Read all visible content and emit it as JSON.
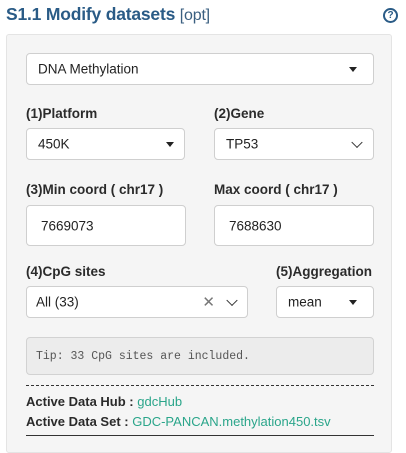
{
  "header": {
    "title": "S1.1 Modify datasets",
    "opt": "[opt]",
    "help_icon": "question-circle-icon"
  },
  "dataset_select": {
    "value": "DNA Methylation"
  },
  "platform": {
    "label": "(1)Platform",
    "value": "450K"
  },
  "gene": {
    "label": "(2)Gene",
    "value": "TP53"
  },
  "min_coord": {
    "label": "(3)Min coord ( chr17 )",
    "value": "7669073"
  },
  "max_coord": {
    "label": "Max coord ( chr17 )",
    "value": "7688630"
  },
  "cpg_sites": {
    "label": "(4)CpG sites",
    "value": "All (33)"
  },
  "aggregation": {
    "label": "(5)Aggregation",
    "value": "mean"
  },
  "tip": {
    "text": "Tip: 33 CpG sites are included."
  },
  "active": {
    "hub_label": "Active Data Hub :",
    "hub_value": "gdcHub",
    "set_label": "Active Data Set :",
    "set_value": "GDC-PANCAN.methylation450.tsv"
  }
}
